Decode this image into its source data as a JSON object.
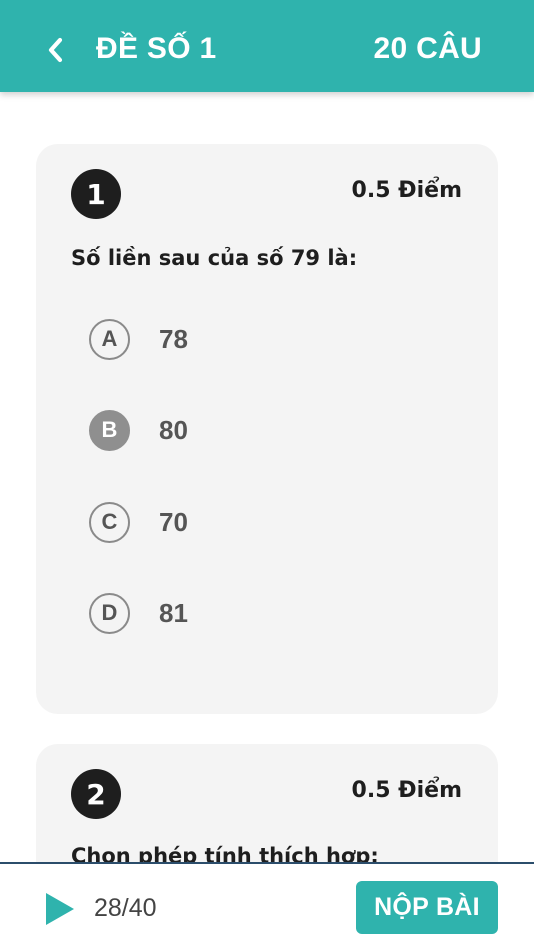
{
  "header": {
    "title": "ĐỀ SỐ 1",
    "question_count": "20 CÂU",
    "back_icon": "chevron-left-icon",
    "background": "#2fb3ad"
  },
  "questions": [
    {
      "number": "1",
      "score": "0.5 Điểm",
      "text": "Số liền sau của số 79 là:",
      "options": [
        {
          "letter": "A",
          "value": "78",
          "selected": false
        },
        {
          "letter": "B",
          "value": "80",
          "selected": true
        },
        {
          "letter": "C",
          "value": "70",
          "selected": false
        },
        {
          "letter": "D",
          "value": "81",
          "selected": false
        }
      ]
    },
    {
      "number": "2",
      "score": "0.5 Điểm",
      "text": "Chọn phép tính thích hợp:"
    }
  ],
  "footer": {
    "play_icon": "play-icon",
    "progress": "28/40",
    "submit_label": "NỘP BÀI",
    "accent": "#2fb3ad"
  }
}
